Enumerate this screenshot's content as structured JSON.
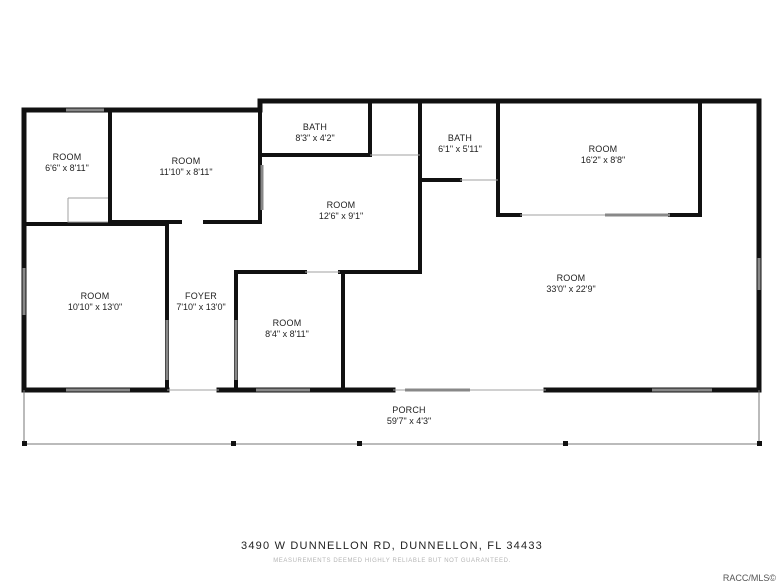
{
  "rooms": {
    "room_a": {
      "name": "ROOM",
      "dims": "6'6\" x 8'11\""
    },
    "room_b": {
      "name": "ROOM",
      "dims": "11'10\" x 8'11\""
    },
    "bath_1": {
      "name": "BATH",
      "dims": "8'3\" x 4'2\""
    },
    "bath_2": {
      "name": "BATH",
      "dims": "6'1\" x 5'11\""
    },
    "room_c": {
      "name": "ROOM",
      "dims": "16'2\" x 8'8\""
    },
    "room_d": {
      "name": "ROOM",
      "dims": "12'6\" x 9'1\""
    },
    "room_e": {
      "name": "ROOM",
      "dims": "10'10\" x 13'0\""
    },
    "foyer": {
      "name": "FOYER",
      "dims": "7'10\" x 13'0\""
    },
    "room_f": {
      "name": "ROOM",
      "dims": "8'4\" x 8'11\""
    },
    "room_g": {
      "name": "ROOM",
      "dims": "33'0\" x 22'9\""
    },
    "porch": {
      "name": "PORCH",
      "dims": "59'7\" x 4'3\""
    }
  },
  "footer": {
    "address": "3490 W DUNNELLON RD, DUNNELLON, FL 34433",
    "disclaimer": "MEASUREMENTS DEEMED HIGHLY RELIABLE BUT NOT GUARANTEED.",
    "credit": "RACC/MLS©"
  },
  "colors": {
    "wall": "#111111",
    "window": "#8a8a8a",
    "thin": "#9a9a9a"
  }
}
